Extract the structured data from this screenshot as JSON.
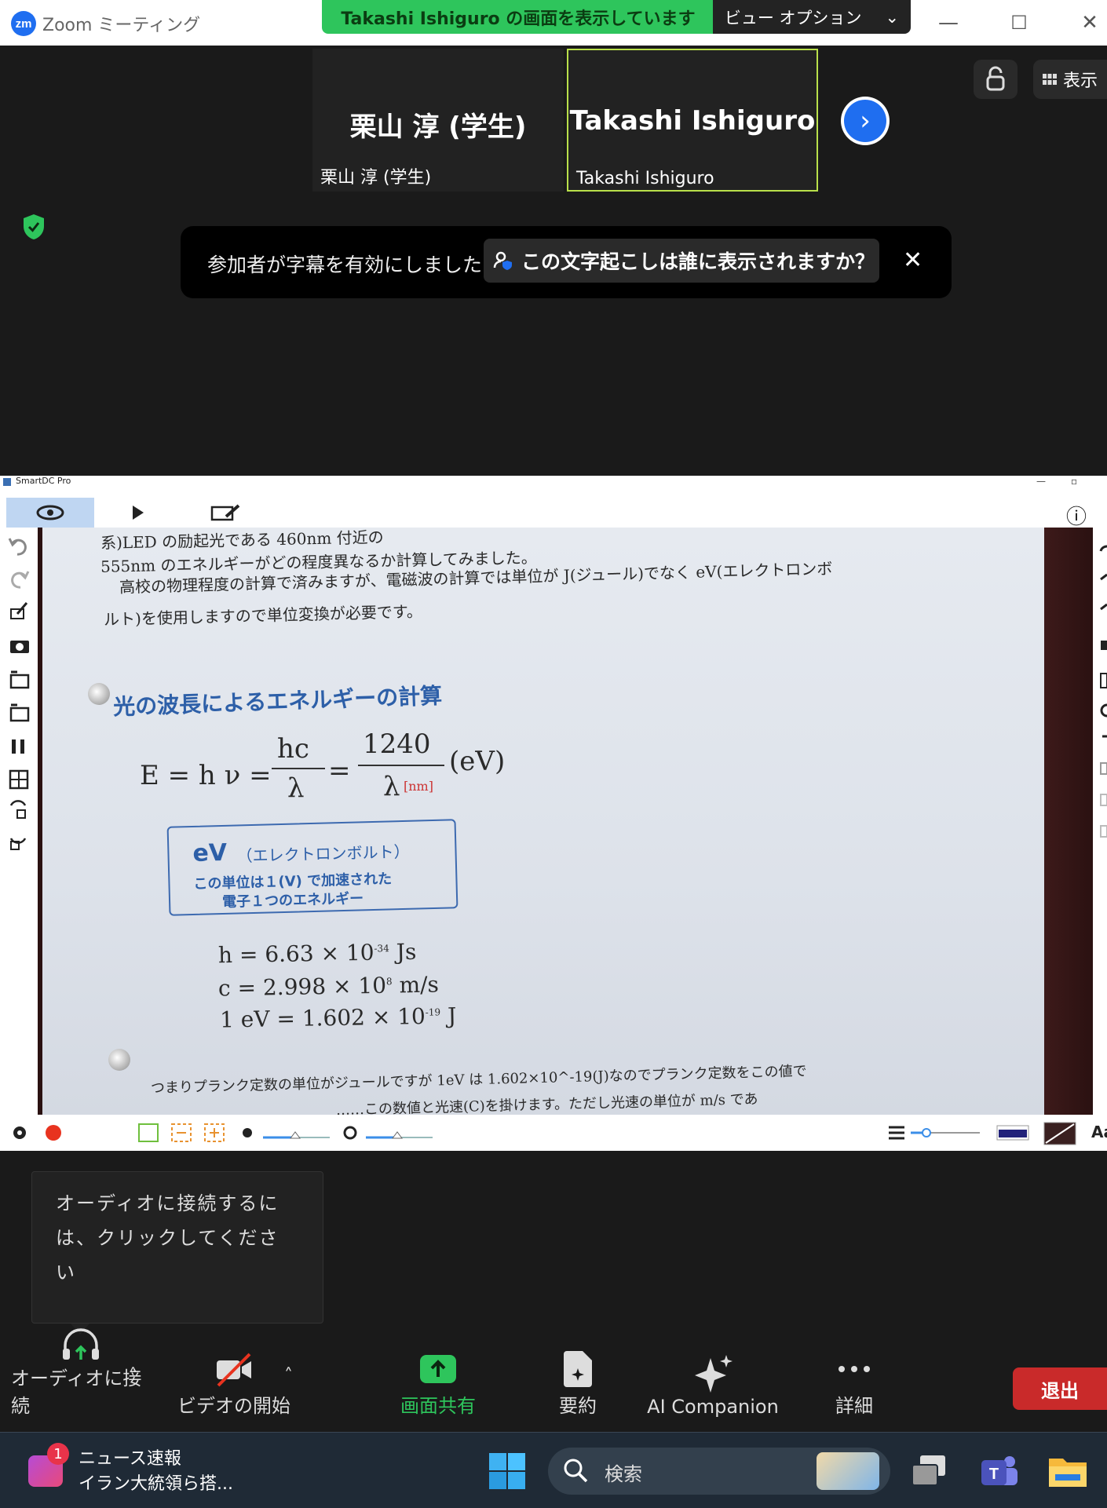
{
  "titlebar": {
    "app_title": "Zoom ミーティング",
    "logo_text": "zm",
    "share_banner": "Takashi Ishiguro の画面を表示しています",
    "view_options": "ビュー オプション",
    "chevron": "⌄",
    "minimize": "—",
    "maximize": "☐",
    "close": "✕"
  },
  "participants": [
    {
      "display": "栗山 淳 (学生)",
      "label": "栗山 淳 (学生)"
    },
    {
      "display": "Takashi Ishiguro",
      "label": "Takashi Ishiguro"
    }
  ],
  "next_arrow": "›",
  "view_button": "表示",
  "caption_toast": {
    "message": "参加者が字幕を有効にしました",
    "link": "この文字起こしは誰に表示されますか？",
    "close": "✕"
  },
  "shared_window": {
    "title": "SmartDC Pro",
    "info_icon": "ⓘ",
    "document": {
      "line1": "系)LED の励起光である 460nm 付近の",
      "line2": "555nm のエネルギーがどの程度異なるか計算してみました。",
      "line3": "高校の物理程度の計算で済みますが、電磁波の計算では単位が J(ジュール)でなく eV(エレクトロンボ",
      "line4": "ルト)を使用しますので単位変換が必要です。",
      "heading": "光の波長によるエネルギーの計算",
      "eq_left": "E = h ν =",
      "eq_hc": "hc",
      "eq_lambda": "λ",
      "eq_equals": "=",
      "eq_1240": "1240",
      "eq_lambda2": "λ",
      "eq_nm": "[nm]",
      "eq_ev": "(eV)",
      "box_title": "eV",
      "box_paren": "（エレクトロンボルト）",
      "box_line1": "この単位は１(V) で加速された",
      "box_line2": "電子１つのエネルギー",
      "const_h": "h = 6.63 × 10",
      "const_h_exp": "-34",
      "const_h_unit": "Js",
      "const_c": "c = 2.998 × 10",
      "const_c_exp": "8",
      "const_c_unit": "m/s",
      "const_ev": "1 eV = 1.602 × 10",
      "const_ev_exp": "-19",
      "const_ev_unit": "J",
      "footer1": "つまりプランク定数の単位がジュールですが 1eV は 1.602×10^-19(J)なのでプランク定数をこの値で",
      "footer2": "……この数値と光速(C)を掛けます。ただし光速の単位が m/s であ"
    },
    "bottom_aa": "Aa"
  },
  "audio_tooltip": {
    "line1": "オーディオに接続するに",
    "line2": "は、クリックしてください"
  },
  "controls": {
    "audio": "オーディオに接続",
    "video": "ビデオの開始",
    "share": "画面共有",
    "summary": "要約",
    "ai": "AI Companion",
    "more": "詳細",
    "leave": "退出"
  },
  "colors": {
    "accent_blue": "#1f6ef0",
    "share_green": "#2ec55c",
    "leave_red": "#c92a2a",
    "highlight_border": "#b9e04a",
    "doc_heading_blue": "#2d5fa8"
  },
  "taskbar": {
    "badge": "1",
    "news_title": "ニュース速報",
    "news_sub": "イラン大統領ら搭...",
    "search": "検索"
  }
}
